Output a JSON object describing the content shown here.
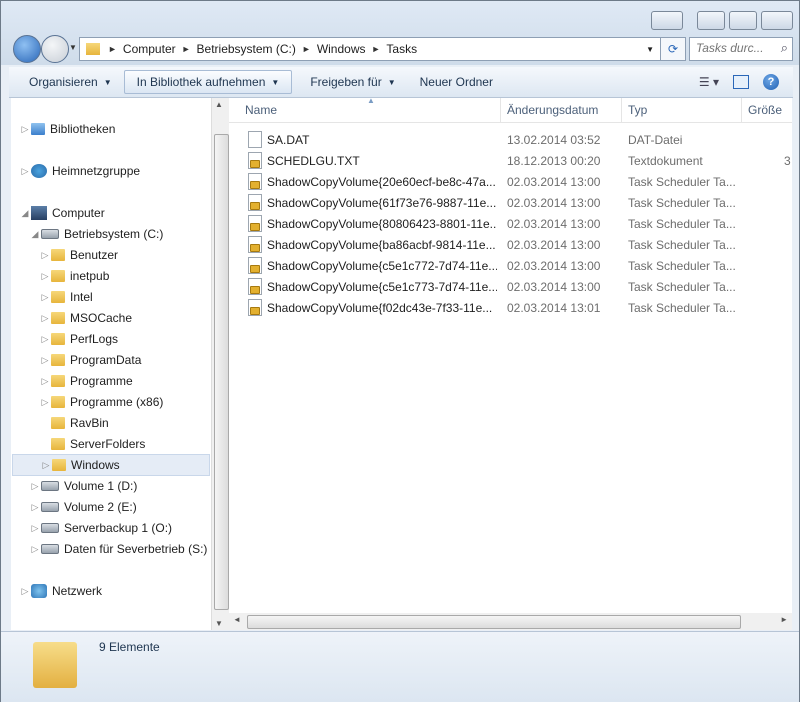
{
  "address": {
    "crumbs": [
      "Computer",
      "Betriebsystem (C:)",
      "Windows",
      "Tasks"
    ]
  },
  "search": {
    "placeholder": "Tasks durc..."
  },
  "toolbar": {
    "organize": "Organisieren",
    "library": "In Bibliothek aufnehmen",
    "share": "Freigeben für",
    "new_folder": "Neuer Ordner"
  },
  "tree": {
    "libraries": "Bibliotheken",
    "homegroup": "Heimnetzgruppe",
    "computer": "Computer",
    "system_drive": "Betriebsystem (C:)",
    "folders": [
      "Benutzer",
      "inetpub",
      "Intel",
      "MSOCache",
      "PerfLogs",
      "ProgramData",
      "Programme",
      "Programme (x86)",
      "RavBin",
      "ServerFolders",
      "Windows"
    ],
    "drives": [
      "Volume 1 (D:)",
      "Volume 2 (E:)",
      "Serverbackup 1 (O:)",
      "Daten für Severbetrieb (S:)"
    ],
    "network": "Netzwerk"
  },
  "columns": {
    "name": "Name",
    "date": "Änderungsdatum",
    "type": "Typ",
    "size": "Größe"
  },
  "files": [
    {
      "name": "SA.DAT",
      "date": "13.02.2014 03:52",
      "type": "DAT-Datei",
      "size": ""
    },
    {
      "name": "SCHEDLGU.TXT",
      "date": "18.12.2013 00:20",
      "type": "Textdokument",
      "size": "3"
    },
    {
      "name": "ShadowCopyVolume{20e60ecf-be8c-47a...",
      "date": "02.03.2014 13:00",
      "type": "Task Scheduler Ta...",
      "size": ""
    },
    {
      "name": "ShadowCopyVolume{61f73e76-9887-11e...",
      "date": "02.03.2014 13:00",
      "type": "Task Scheduler Ta...",
      "size": ""
    },
    {
      "name": "ShadowCopyVolume{80806423-8801-11e...",
      "date": "02.03.2014 13:00",
      "type": "Task Scheduler Ta...",
      "size": ""
    },
    {
      "name": "ShadowCopyVolume{ba86acbf-9814-11e...",
      "date": "02.03.2014 13:00",
      "type": "Task Scheduler Ta...",
      "size": ""
    },
    {
      "name": "ShadowCopyVolume{c5e1c772-7d74-11e...",
      "date": "02.03.2014 13:00",
      "type": "Task Scheduler Ta...",
      "size": ""
    },
    {
      "name": "ShadowCopyVolume{c5e1c773-7d74-11e...",
      "date": "02.03.2014 13:00",
      "type": "Task Scheduler Ta...",
      "size": ""
    },
    {
      "name": "ShadowCopyVolume{f02dc43e-7f33-11e...",
      "date": "02.03.2014 13:01",
      "type": "Task Scheduler Ta...",
      "size": ""
    }
  ],
  "status": {
    "count": "9 Elemente"
  }
}
